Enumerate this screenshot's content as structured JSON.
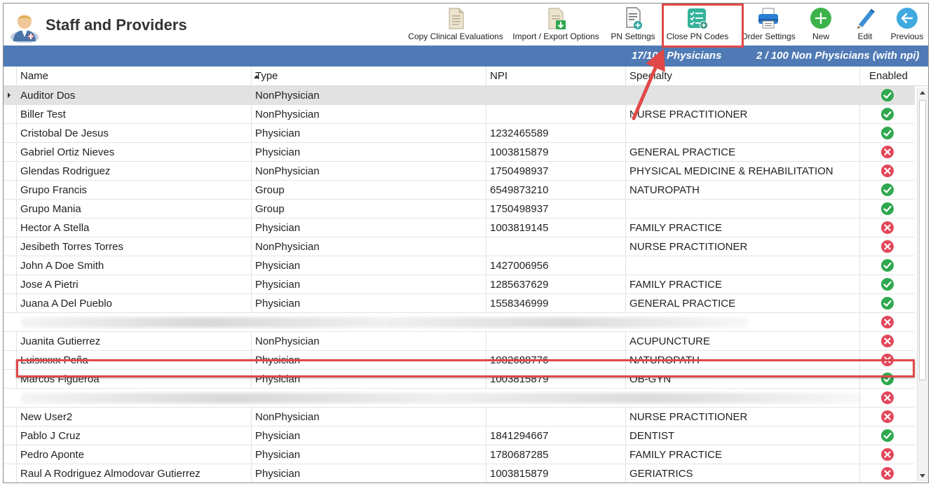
{
  "app": {
    "title": "Staff and Providers"
  },
  "toolbar": [
    {
      "label": "Copy Clinical Evaluations",
      "icon": "document-copy-icon"
    },
    {
      "label": "Import / Export Options",
      "icon": "document-import-icon"
    },
    {
      "label": "PN Settings",
      "icon": "document-settings-icon"
    },
    {
      "label": "Close PN Codes",
      "icon": "checklist-icon"
    },
    {
      "label": "Order Settings",
      "icon": "printer-icon"
    },
    {
      "label": "New",
      "icon": "plus-circle-icon"
    },
    {
      "label": "Edit",
      "icon": "pencil-icon"
    },
    {
      "label": "Previous",
      "icon": "back-arrow-icon"
    }
  ],
  "counts": {
    "physicians": "17/100 Physicians",
    "non_physicians": "2 / 100 Non Physicians (with npi)"
  },
  "columns": {
    "name": "Name",
    "type": "Type",
    "npi": "NPI",
    "specialty": "Specialty",
    "enabled": "Enabled"
  },
  "rows": [
    {
      "name": "Auditor Dos",
      "type": "NonPhysician",
      "npi": "",
      "specialty": "",
      "enabled": true
    },
    {
      "name": "Biller Test",
      "type": "NonPhysician",
      "npi": "",
      "specialty": "NURSE PRACTITIONER",
      "enabled": true
    },
    {
      "name": "Cristobal De Jesus",
      "type": "Physician",
      "npi": "1232465589",
      "specialty": "",
      "enabled": true
    },
    {
      "name": "Gabriel Ortiz Nieves",
      "type": "Physician",
      "npi": "1003815879",
      "specialty": "GENERAL PRACTICE",
      "enabled": false
    },
    {
      "name": "Glendas Rodriguez",
      "type": "NonPhysician",
      "npi": "1750498937",
      "specialty": "PHYSICAL MEDICINE & REHABILITATION",
      "enabled": false
    },
    {
      "name": "Grupo Francis",
      "type": "Group",
      "npi": "6549873210",
      "specialty": "NATUROPATH",
      "enabled": true
    },
    {
      "name": "Grupo Mania",
      "type": "Group",
      "npi": "1750498937",
      "specialty": "",
      "enabled": true
    },
    {
      "name": "Hector A Stella",
      "type": "Physician",
      "npi": "1003819145",
      "specialty": "FAMILY PRACTICE",
      "enabled": false
    },
    {
      "name": "Jesibeth Torres Torres",
      "type": "NonPhysician",
      "npi": "",
      "specialty": "NURSE PRACTITIONER",
      "enabled": false
    },
    {
      "name": "John A Doe Smith",
      "type": "Physician",
      "npi": "1427006956",
      "specialty": "",
      "enabled": true
    },
    {
      "name": "Jose A Pietri",
      "type": "Physician",
      "npi": "1285637629",
      "specialty": "FAMILY PRACTICE",
      "enabled": true
    },
    {
      "name": "Juana A Del Pueblo",
      "type": "Physician",
      "npi": "1558346999",
      "specialty": "GENERAL PRACTICE",
      "enabled": true
    },
    {
      "name": "",
      "type": "",
      "npi": "",
      "specialty": "",
      "enabled": false
    },
    {
      "name": "Juanita Gutierrez",
      "type": "NonPhysician",
      "npi": "",
      "specialty": "ACUPUNCTURE",
      "enabled": false
    },
    {
      "name": "Luisxxxx Peña",
      "type": "Physician",
      "npi": "1982688776",
      "specialty": "NATUROPATH",
      "enabled": false
    },
    {
      "name": "Marcos Figueroa",
      "type": "Physician",
      "npi": "1003815879",
      "specialty": "OB-GYN",
      "enabled": true
    },
    {
      "name": "",
      "type": "",
      "npi": "",
      "specialty": "",
      "enabled": false
    },
    {
      "name": "New User2",
      "type": "NonPhysician",
      "npi": "",
      "specialty": "NURSE PRACTITIONER",
      "enabled": false
    },
    {
      "name": "Pablo J Cruz",
      "type": "Physician",
      "npi": "1841294667",
      "specialty": "DENTIST",
      "enabled": true
    },
    {
      "name": "Pedro Aponte",
      "type": "Physician",
      "npi": "1780687285",
      "specialty": "FAMILY PRACTICE",
      "enabled": false
    },
    {
      "name": "Raul A Rodriguez Almodovar Gutierrez",
      "type": "Physician",
      "npi": "1003815879",
      "specialty": "GERIATRICS",
      "enabled": false
    }
  ],
  "colors": {
    "accent_bar": "#4f7ab5",
    "enabled_true": "#2fa84f",
    "enabled_false": "#e2475a",
    "annotation": "#e04848"
  }
}
